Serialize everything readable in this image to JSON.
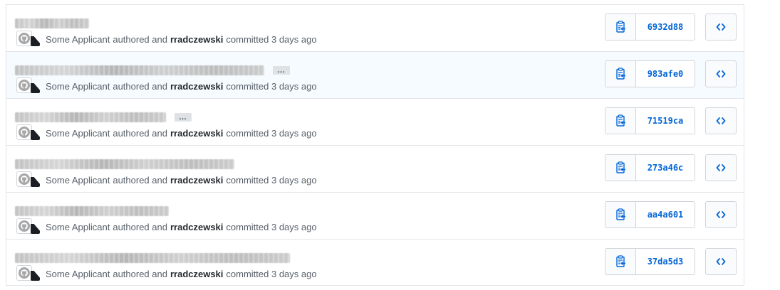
{
  "commits": [
    {
      "title_width": 104,
      "has_ellipsis": false,
      "highlight": false,
      "author": "Some Applicant",
      "authored_text": "authored and",
      "committer": "rradczewski",
      "committed_text": "committed 3 days ago",
      "sha": "6932d88"
    },
    {
      "title_width": 350,
      "has_ellipsis": true,
      "highlight": true,
      "author": "Some Applicant",
      "authored_text": "authored and",
      "committer": "rradczewski",
      "committed_text": "committed 3 days ago",
      "sha": "983afe0"
    },
    {
      "title_width": 212,
      "has_ellipsis": true,
      "highlight": false,
      "author": "Some Applicant",
      "authored_text": "authored and",
      "committer": "rradczewski",
      "committed_text": "committed 3 days ago",
      "sha": "71519ca"
    },
    {
      "title_width": 308,
      "has_ellipsis": false,
      "highlight": false,
      "author": "Some Applicant",
      "authored_text": "authored and",
      "committer": "rradczewski",
      "committed_text": "committed 3 days ago",
      "sha": "273a46c"
    },
    {
      "title_width": 216,
      "has_ellipsis": false,
      "highlight": false,
      "author": "Some Applicant",
      "authored_text": "authored and",
      "committer": "rradczewski",
      "committed_text": "committed 3 days ago",
      "sha": "aa4a601"
    },
    {
      "title_width": 386,
      "has_ellipsis": false,
      "highlight": false,
      "author": "Some Applicant",
      "authored_text": "authored and",
      "committer": "rradczewski",
      "committed_text": "committed 3 days ago",
      "sha": "37da5d3"
    }
  ],
  "ellipsis_label": "…",
  "icons": {
    "copy": "clipboard-copy-icon",
    "browse": "code-icon",
    "avatar": "github-avatar-icon"
  },
  "colors": {
    "sha_link": "#0366d6",
    "highlight_row": "#f6fbff"
  }
}
